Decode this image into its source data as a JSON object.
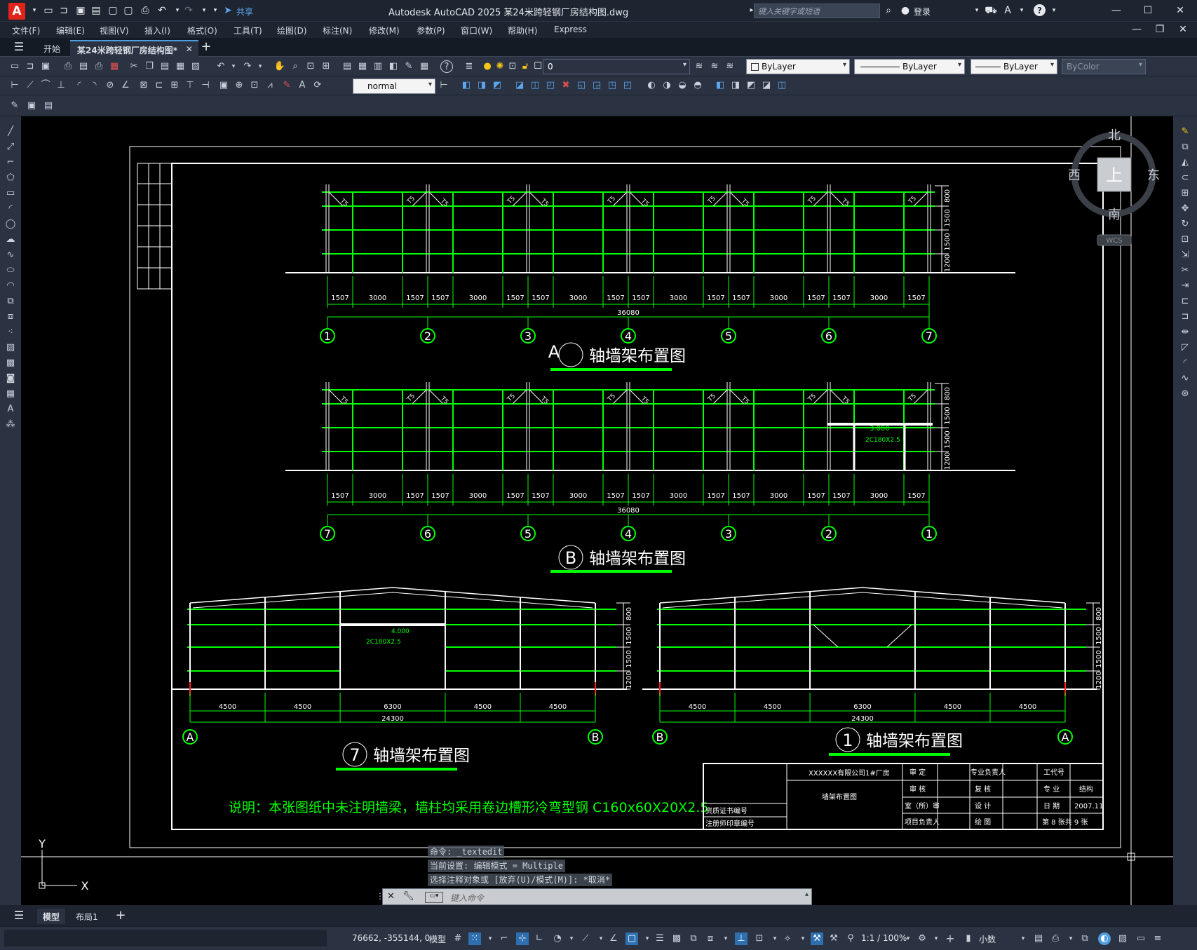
{
  "app": {
    "title": "Autodesk AutoCAD 2025    某24米跨轻钢厂房结构图.dwg",
    "search_placeholder": "键入关键字或短语",
    "share_label": "共享",
    "login_label": "登录"
  },
  "menu": [
    "文件(F)",
    "编辑(E)",
    "视图(V)",
    "插入(I)",
    "格式(O)",
    "工具(T)",
    "绘图(D)",
    "标注(N)",
    "修改(M)",
    "参数(P)",
    "窗口(W)",
    "帮助(H)",
    "Express"
  ],
  "tabs": {
    "start": "开始",
    "doc": "某24米跨轻钢厂房结构图*"
  },
  "toolbar": {
    "layer_value": "0",
    "color_value": "ByLayer",
    "linetype_value": "ByLayer",
    "lineweight_value": "ByLayer",
    "plotstyle_value": "ByColor",
    "dimstyle_value": "normal"
  },
  "viewcube": {
    "north": "北",
    "south": "南",
    "east": "东",
    "west": "西",
    "top": "上",
    "wcs": "WCS"
  },
  "drawing": {
    "elev_a": {
      "title": "轴墙架布置图",
      "axis_letter": "A",
      "dims": [
        "1507",
        "3000",
        "1507",
        "1507",
        "3000",
        "1507",
        "1507",
        "3000",
        "1507",
        "1507",
        "3000",
        "1507",
        "1507",
        "3000",
        "1507",
        "1507",
        "3000",
        "1507"
      ],
      "total": "36080",
      "axes": [
        "1",
        "2",
        "3",
        "4",
        "5",
        "6",
        "7"
      ],
      "vdims": [
        "800",
        "1500",
        "1500",
        "1200"
      ],
      "brace_label": "T5"
    },
    "elev_b": {
      "title": "轴墙架布置图",
      "axis_letter": "B",
      "dims": [
        "1507",
        "3000",
        "1507",
        "1507",
        "3000",
        "1507",
        "1507",
        "3000",
        "1507",
        "1507",
        "3000",
        "1507",
        "1507",
        "3000",
        "1507",
        "1507",
        "3000",
        "1507"
      ],
      "total": "36080",
      "axes": [
        "7",
        "6",
        "5",
        "4",
        "3",
        "2",
        "1"
      ],
      "vdims": [
        "800",
        "1500",
        "1500",
        "1200"
      ],
      "door_level": "3.000",
      "door_beam": "2C180X2.5"
    },
    "elev_7": {
      "title": "轴墙架布置图",
      "axis_number": "7",
      "dims": [
        "4500",
        "4500",
        "6300",
        "4500",
        "4500"
      ],
      "total": "24300",
      "axes": [
        "A",
        "B"
      ],
      "vdims": [
        "800",
        "1500",
        "1500",
        "1200"
      ],
      "door_level": "4.000",
      "door_beam": "2C180X2.5"
    },
    "elev_1": {
      "title": "轴墙架布置图",
      "axis_number": "1",
      "dims": [
        "4500",
        "4500",
        "6300",
        "4500",
        "4500"
      ],
      "total": "24300",
      "axes": [
        "B",
        "A"
      ],
      "vdims": [
        "800",
        "1500",
        "1500",
        "1200"
      ]
    },
    "note": "说明：本张图纸中未注明墙梁，墙柱均采用卷边槽形冷弯型钢 C160x60X20X2.5",
    "titleblock": {
      "company": "XXXXXX有限公司1#厂房",
      "drawing_name": "墙架布置图",
      "cert_no": "资质证书编号",
      "reg_no": "注册师印章编号",
      "r1": [
        "审 定",
        "专业负责人",
        "工代号"
      ],
      "r2": [
        "审 核",
        "复 核",
        "专 业",
        "结构"
      ],
      "r3": [
        "室（所）审",
        "设 计",
        "日 期",
        "2007.11"
      ],
      "r4": [
        "项目负责人",
        "绘 图",
        "第 8 张共 9 张"
      ]
    }
  },
  "ucs": {
    "x": "X",
    "y": "Y"
  },
  "command": {
    "history": [
      "命令: _textedit",
      "当前设置: 编辑模式 = Multiple",
      "选择注释对象或 [放弃(U)/模式(M)]: *取消*"
    ],
    "placeholder": "键入命令"
  },
  "layout_tabs": [
    "模型",
    "布局1"
  ],
  "status": {
    "coords": "76662, -355144, 0",
    "model": "模型",
    "scale": "1:1 / 100%",
    "units": "小数"
  },
  "colors": {
    "accent": "#4d9de0",
    "green": "#00ff00",
    "canvas": "#000000"
  }
}
